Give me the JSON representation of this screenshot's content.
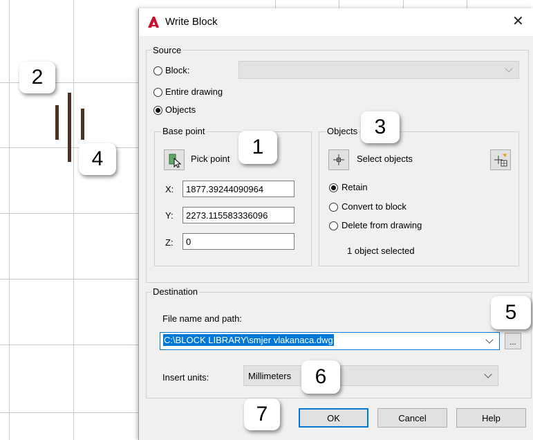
{
  "dialog": {
    "title": "Write Block",
    "close_glyph": "✕",
    "app_icon": "autocad-icon"
  },
  "source": {
    "group_label": "Source",
    "block_label": "Block:",
    "entire_drawing_label": "Entire drawing",
    "objects_label": "Objects",
    "selected_option": "Objects"
  },
  "base_point": {
    "group_label": "Base point",
    "pick_point_label": "Pick point",
    "x_label": "X:",
    "x_value": "1877.39244090964",
    "y_label": "Y:",
    "y_value": "2273.115583336096",
    "z_label": "Z:",
    "z_value": "0"
  },
  "objects": {
    "group_label": "Objects",
    "select_objects_label": "Select objects",
    "retain_label": "Retain",
    "convert_label": "Convert to block",
    "delete_label": "Delete from drawing",
    "selected_option": "Retain",
    "status": "1 object selected"
  },
  "destination": {
    "group_label": "Destination",
    "file_label": "File name and path:",
    "file_value": "C:\\BLOCK LIBRARY\\smjer vlakanaca.dwg",
    "browse_label": "...",
    "units_label": "Insert units:",
    "units_value": "Millimeters"
  },
  "buttons": {
    "ok": "OK",
    "cancel": "Cancel",
    "help": "Help"
  },
  "callouts": [
    "1",
    "2",
    "3",
    "4",
    "5",
    "6",
    "7"
  ],
  "colors": {
    "accent": "#0078d7",
    "selection": "#0078d7",
    "autocad_red": "#c8102e",
    "bar_brown": "#4a3322"
  }
}
